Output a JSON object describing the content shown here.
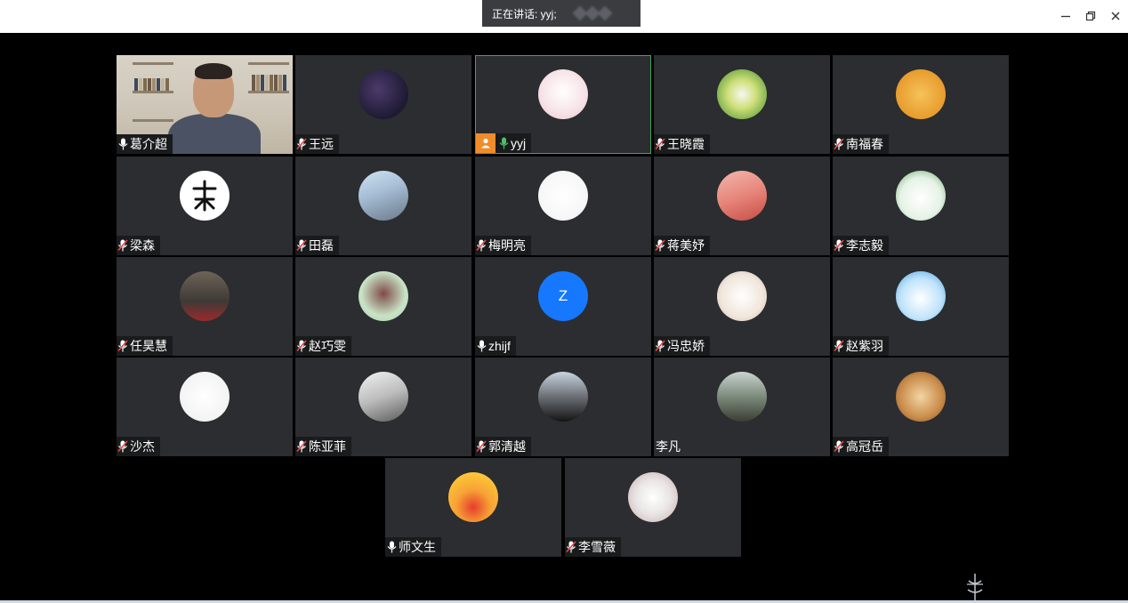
{
  "speaking": {
    "label": "正在讲话: yyj;"
  },
  "window_controls": {
    "minimize": "minimize-icon",
    "restore": "restore-icon",
    "close": "close-icon"
  },
  "colors": {
    "tile_bg": "#2b2d30",
    "active_border": "#3ea85a",
    "mic_active": "#4fbf6a",
    "mic_muted_slash": "#e04848",
    "host_badge": "#f08c2a",
    "avatar_letter_bg": "#1677ff"
  },
  "participants": [
    {
      "name": "葛介超",
      "mic": "on",
      "video": true
    },
    {
      "name": "王远",
      "mic": "muted"
    },
    {
      "name": "yyj",
      "mic": "on",
      "speaking": true,
      "host": true
    },
    {
      "name": "王晓霞",
      "mic": "muted"
    },
    {
      "name": "南福春",
      "mic": "muted"
    },
    {
      "name": "梁森",
      "mic": "muted"
    },
    {
      "name": "田磊",
      "mic": "muted"
    },
    {
      "name": "梅明亮",
      "mic": "muted"
    },
    {
      "name": "蒋美妤",
      "mic": "muted"
    },
    {
      "name": "李志毅",
      "mic": "muted"
    },
    {
      "name": "任昊慧",
      "mic": "muted"
    },
    {
      "name": "赵巧雯",
      "mic": "muted"
    },
    {
      "name": "zhijf",
      "mic": "on",
      "avatar_letter": "Z"
    },
    {
      "name": "冯忠娇",
      "mic": "muted"
    },
    {
      "name": "赵紫羽",
      "mic": "muted"
    },
    {
      "name": "沙杰",
      "mic": "muted"
    },
    {
      "name": "陈亚菲",
      "mic": "muted"
    },
    {
      "name": "郭清越",
      "mic": "muted"
    },
    {
      "name": "李凡",
      "mic": "none"
    },
    {
      "name": "高冠岳",
      "mic": "muted"
    },
    {
      "name": "师文生",
      "mic": "on"
    },
    {
      "name": "李雪薇",
      "mic": "muted"
    }
  ]
}
